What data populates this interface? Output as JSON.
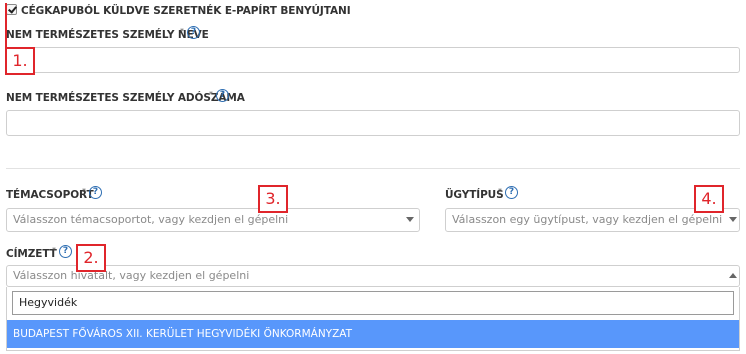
{
  "form": {
    "cegkapu_checkbox_label": "CÉGKAPUBÓL KÜLDVE SZERETNÉK E-PAPÍRT BENYÚJTANI",
    "cegkapu_checked": true,
    "entity_name_label": "NEM TERMÉSZETES SZEMÉLY NEVE",
    "entity_name_value": "",
    "tax_number_label": "NEM TERMÉSZETES SZEMÉLY ADÓSZÁMA",
    "tax_number_value": "",
    "required_mark": "*",
    "help_glyph": "?",
    "topic_group_label": "TÉMACSOPORT",
    "topic_group_placeholder": "Válasszon témacsoportot, vagy kezdjen el gépelni",
    "case_type_label": "ÜGYTÍPUS",
    "case_type_placeholder": "Válasszon egy ügytípust, vagy kezdjen el gépelni",
    "recipient_label": "CÍMZETT",
    "recipient_placeholder": "Válasszon hivatalt, vagy kezdjen el gépelni",
    "recipient_search_value": "Hegyvidék",
    "recipient_options": [
      "BUDAPEST FŐVÁROS XII. KERÜLET HEGYVIDÉKI ÖNKORMÁNYZAT"
    ]
  },
  "annotations": [
    "1.",
    "2.",
    "3.",
    "4."
  ],
  "colors": {
    "annotation_red": "#e0252b",
    "help_blue": "#2f6fb3",
    "highlight_option": "#5897fb"
  },
  "icons": {
    "help": "question-circle-icon",
    "select_arrow": "caret-down-icon",
    "select_open_arrow": "caret-up-icon"
  }
}
